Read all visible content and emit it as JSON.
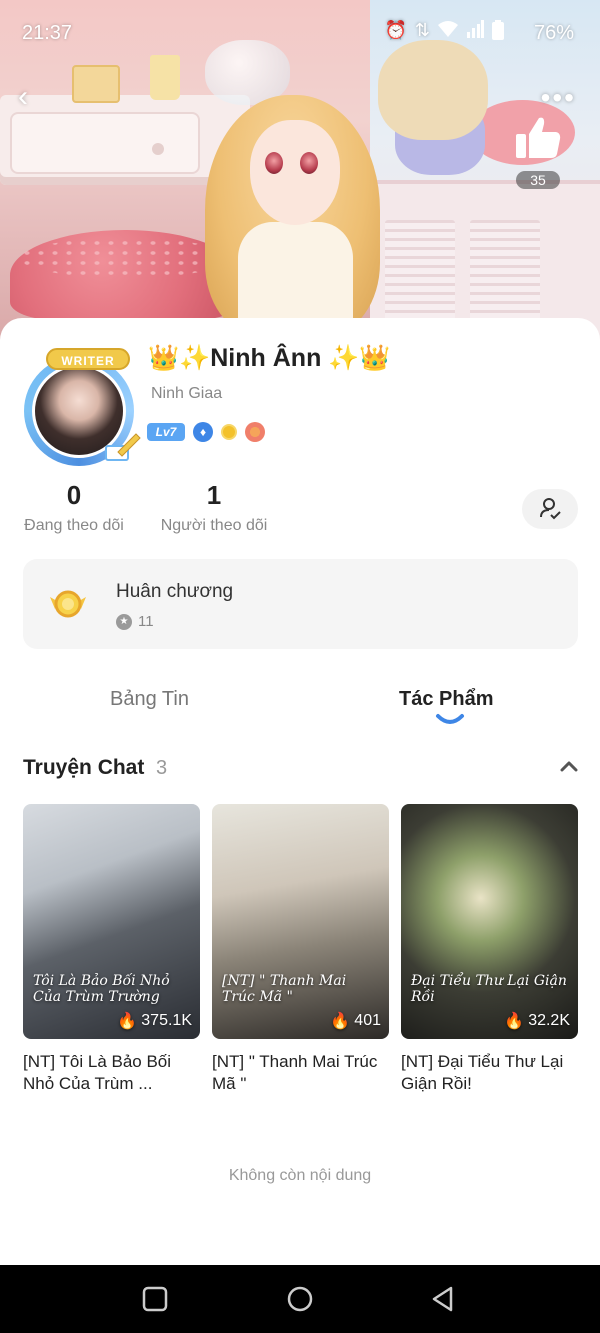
{
  "status_bar": {
    "time": "21:37",
    "battery": "76%",
    "icons": [
      "alarm-icon",
      "data-arrows-icon",
      "wifi-icon",
      "signal-icon",
      "battery-icon"
    ]
  },
  "header": {
    "back_icon": "back-arrow-icon",
    "more_icon": "more-dots-icon",
    "like_icon": "thumbs-up-icon",
    "like_count": "35"
  },
  "profile": {
    "avatar_badge": "WRITER",
    "display_name": "👑✨Ninh Ânn ✨👑",
    "username": "Ninh Giaa",
    "level": "Lv7",
    "badges": [
      "drop-badge-icon",
      "coin-badge-icon",
      "flower-badge-icon"
    ]
  },
  "stats": {
    "following_count": "0",
    "following_label": "Đang theo dõi",
    "followers_count": "1",
    "followers_label": "Người theo dõi"
  },
  "medals": {
    "title": "Huân chương",
    "count": "11"
  },
  "tabs": {
    "feed": "Bảng Tin",
    "works": "Tác Phẩm",
    "active": "works"
  },
  "section": {
    "title": "Truyện Chat",
    "count": "3"
  },
  "stories": [
    {
      "cover_text": "Tôi Là Bảo Bối Nhỏ Của Trùm Trường",
      "views": "375.1K",
      "title": "[NT] Tôi Là Bảo Bối Nhỏ Của Trùm ..."
    },
    {
      "cover_text": "[NT] \" Thanh Mai Trúc Mã \"",
      "views": "401",
      "title": "[NT] \" Thanh Mai Trúc Mã \""
    },
    {
      "cover_text": "Đại Tiểu Thư Lại Giận Rồi",
      "views": "32.2K",
      "title": "[NT] Đại Tiểu Thư Lại Giận Rồi!"
    }
  ],
  "end_text": "Không còn nội dung",
  "colors": {
    "accent_blue": "#3e86e6",
    "level_blue": "#5aa5f3",
    "medal_gold": "#f3c12b"
  }
}
